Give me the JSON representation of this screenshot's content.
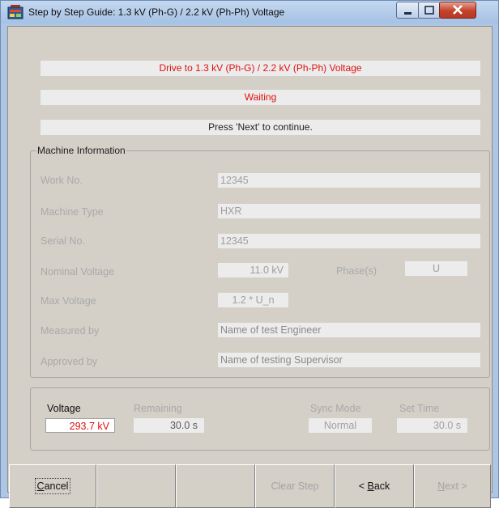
{
  "window": {
    "title": "Step by Step Guide: 1.3 kV (Ph-G) / 2.2 kV (Ph-Ph) Voltage",
    "icon": "app-icon"
  },
  "status": {
    "instruction": "Drive to 1.3 kV (Ph-G) / 2.2 kV (Ph-Ph) Voltage",
    "state": "Waiting",
    "hint": "Press 'Next' to continue."
  },
  "machine_info": {
    "legend": "Machine Information",
    "work_no_label": "Work No.",
    "work_no": "12345",
    "machine_type_label": "Machine Type",
    "machine_type": "HXR",
    "serial_no_label": "Serial No.",
    "serial_no": "12345",
    "nominal_voltage_label": "Nominal Voltage",
    "nominal_voltage": "11.0 kV",
    "phase_label": "Phase(s)",
    "phase": "U",
    "max_voltage_label": "Max Voltage",
    "max_voltage": "1.2 * U_n",
    "measured_by_label": "Measured by",
    "measured_by": "Name of test Engineer",
    "approved_by_label": "Approved by",
    "approved_by": "Name of testing Supervisor"
  },
  "readout": {
    "voltage_label": "Voltage",
    "voltage": "293.7 kV",
    "remaining_label": "Remaining",
    "remaining": "30.0  s",
    "sync_mode_label": "Sync Mode",
    "sync_mode": "Normal",
    "set_time_label": "Set Time",
    "set_time": "30.0  s"
  },
  "buttons": {
    "cancel_rest": "ancel",
    "cancel_key": "C",
    "clear_step": "Clear Step",
    "back_prefix": "< ",
    "back_key": "B",
    "back_rest": "ack",
    "next_prefix": "",
    "next_key": "N",
    "next_rest": "ext >"
  },
  "colors": {
    "highlight_red": "#e01010",
    "frame_blue": "#aec6e3",
    "dialog_gray": "#d4d0c8"
  }
}
